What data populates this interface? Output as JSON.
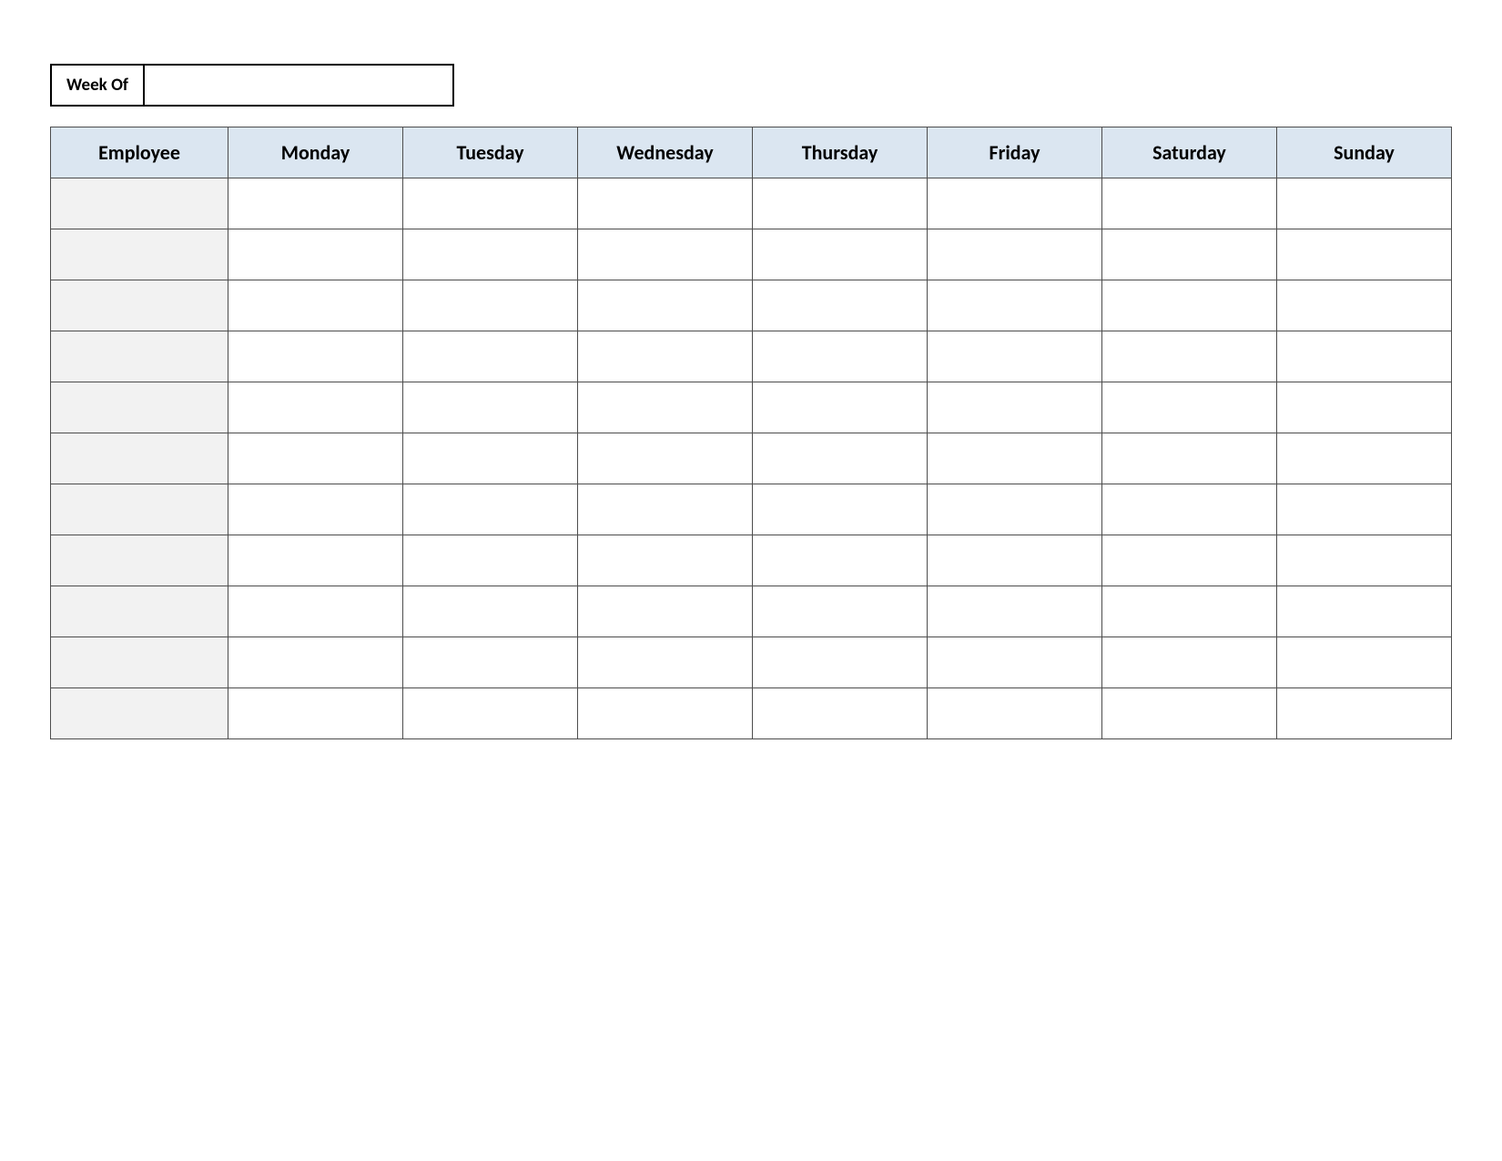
{
  "weekof": {
    "label": "Week Of",
    "value": ""
  },
  "schedule": {
    "headers": [
      "Employee",
      "Monday",
      "Tuesday",
      "Wednesday",
      "Thursday",
      "Friday",
      "Saturday",
      "Sunday"
    ],
    "rows": [
      {
        "employee": "",
        "mon": "",
        "tue": "",
        "wed": "",
        "thu": "",
        "fri": "",
        "sat": "",
        "sun": ""
      },
      {
        "employee": "",
        "mon": "",
        "tue": "",
        "wed": "",
        "thu": "",
        "fri": "",
        "sat": "",
        "sun": ""
      },
      {
        "employee": "",
        "mon": "",
        "tue": "",
        "wed": "",
        "thu": "",
        "fri": "",
        "sat": "",
        "sun": ""
      },
      {
        "employee": "",
        "mon": "",
        "tue": "",
        "wed": "",
        "thu": "",
        "fri": "",
        "sat": "",
        "sun": ""
      },
      {
        "employee": "",
        "mon": "",
        "tue": "",
        "wed": "",
        "thu": "",
        "fri": "",
        "sat": "",
        "sun": ""
      },
      {
        "employee": "",
        "mon": "",
        "tue": "",
        "wed": "",
        "thu": "",
        "fri": "",
        "sat": "",
        "sun": ""
      },
      {
        "employee": "",
        "mon": "",
        "tue": "",
        "wed": "",
        "thu": "",
        "fri": "",
        "sat": "",
        "sun": ""
      },
      {
        "employee": "",
        "mon": "",
        "tue": "",
        "wed": "",
        "thu": "",
        "fri": "",
        "sat": "",
        "sun": ""
      },
      {
        "employee": "",
        "mon": "",
        "tue": "",
        "wed": "",
        "thu": "",
        "fri": "",
        "sat": "",
        "sun": ""
      },
      {
        "employee": "",
        "mon": "",
        "tue": "",
        "wed": "",
        "thu": "",
        "fri": "",
        "sat": "",
        "sun": ""
      },
      {
        "employee": "",
        "mon": "",
        "tue": "",
        "wed": "",
        "thu": "",
        "fri": "",
        "sat": "",
        "sun": ""
      }
    ]
  }
}
